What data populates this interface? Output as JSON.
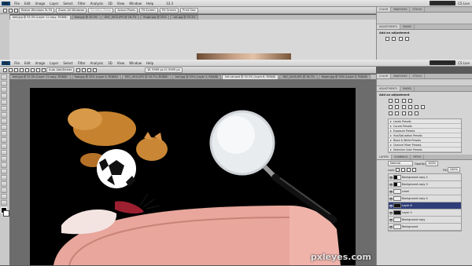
{
  "app": {
    "logo": "Ps",
    "workspace": "ESSENTIALS",
    "cs_live": "CS Live"
  },
  "menu": [
    "File",
    "Edit",
    "Image",
    "Layer",
    "Select",
    "Filter",
    "Analysis",
    "3D",
    "View",
    "Window",
    "Help"
  ],
  "options_top": {
    "buttons": [
      "Resize Windows To Fit",
      "Zoom All Windows",
      "Scrubby Zoom",
      "Actual Pixels",
      "Fit Screen",
      "Fill Screen",
      "Print Size"
    ],
    "zoom": "33.3"
  },
  "top_doc_tabs": [
    "bed.jpg @ 33.3% (Layer 11 copy, RGB/8)",
    "foot.jpg @ 33.3%",
    "DSC_0012.JPG @ 16.7%",
    "finger.jpg @ 25%",
    "cat.jpg @ 33.3%"
  ],
  "options_bottom": {
    "auto_add_delete": "Auto Add/Delete",
    "readout": "W: 9999 px  H: 9999 px"
  },
  "doc_tabs": [
    "bed.jpg @ 33.3% (Layer 11 copy, RGB/8)",
    "foot.jpg @ 25% (Layer 0, RGB/8)",
    "DSC_0012.JPG @ 16.7% (RGB/8)",
    "ball.jpg @ 25% (Layer 1, RGB/8)",
    "kid cat.psd @ 33.3% (Layer 8, RGB/8)",
    "DSC_0045.JPG @ 16.7%",
    "finger.jpg @ 25% (Layer 0, RGB/8)"
  ],
  "right_panel_top": {
    "tabs": [
      "COLOR",
      "SWATCHES",
      "STYLES"
    ],
    "tabs2": [
      "ADJUSTMENTS",
      "MASKS"
    ],
    "add_adjustment": "Add an adjustment"
  },
  "right_panel_main": {
    "tabs": [
      "COLOR",
      "SWATCHES",
      "STYLES"
    ],
    "tabs2": [
      "ADJUSTMENTS",
      "MASKS"
    ],
    "add_adjustment": "Add an adjustment",
    "presets": [
      "Levels Presets",
      "Curves Presets",
      "Exposure Presets",
      "Hue/Saturation Presets",
      "Black & White Presets",
      "Channel Mixer Presets",
      "Selective Color Presets"
    ]
  },
  "layers_panel": {
    "tabs": [
      "LAYERS",
      "CHANNELS",
      "PATHS"
    ],
    "blend_mode": "Normal",
    "opacity_label": "Opacity:",
    "opacity": "100%",
    "lock_label": "Lock:",
    "fill_label": "Fill:",
    "fill": "100%",
    "layers": [
      {
        "name": "Background copy 2",
        "thumb": "mask",
        "selected": false
      },
      {
        "name": "Background copy 3",
        "thumb": "mask",
        "selected": false
      },
      {
        "name": "Level",
        "thumb": "light",
        "selected": false
      },
      {
        "name": "Background copy 4",
        "thumb": "light",
        "selected": false
      },
      {
        "name": "Layer 8",
        "thumb": "dark",
        "selected": true
      },
      {
        "name": "Layer 2",
        "thumb": "dark",
        "selected": false
      },
      {
        "name": "Background copy",
        "thumb": "light",
        "selected": false
      },
      {
        "name": "Background",
        "thumb": "light",
        "selected": false
      }
    ]
  },
  "watermark": "pxleyes.com",
  "colors": {
    "selected_layer": "#2f3e78",
    "canvas_bg": "#000000",
    "workspace": "#6c6c6c"
  }
}
